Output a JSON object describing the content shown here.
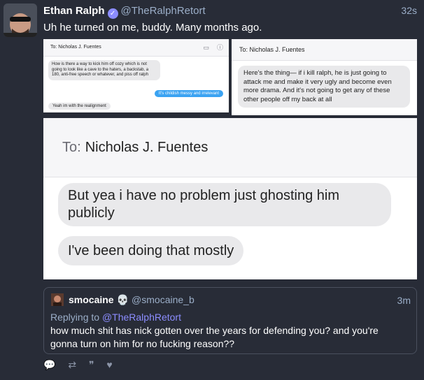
{
  "post": {
    "display_name": "Ethan Ralph",
    "handle": "@TheRalphRetort",
    "time": "32s",
    "text": "Uh he turned on me, buddy. Many months ago.",
    "verified_glyph": "✓"
  },
  "screenshot1": {
    "to": "To: Nicholas J. Fuentes",
    "msg1": "How is there a way to kick him off cozy which is not going to look like a cave to the haters, a backstab, a 180, anti-free speech or whatever, and piss off ralph",
    "msg2": "It's childish messy and irrelevant",
    "msg3": "Yeah im with the realignment",
    "icon_video": "▭",
    "icon_info": "ⓘ"
  },
  "screenshot2": {
    "to": "To: Nicholas J. Fuentes",
    "msg": "Here's the thing— if i kill ralph, he is just going to attack me and make it very ugly and become even more drama. And it's not going to get any of these other people off my back at all"
  },
  "screenshot3": {
    "to_label": "To:",
    "to_name": "Nicholas J. Fuentes",
    "msg1": "But yea i have no problem just ghosting him publicly",
    "msg2": "I've been doing that mostly"
  },
  "quote": {
    "display_name": "smocaine",
    "skull": "💀",
    "handle": "@smocaine_b",
    "time": "3m",
    "replying_label": "Replying to",
    "replying_mention": "@TheRalphRetort",
    "text": "how much shit has nick gotten over the years for defending you? and you're gonna turn on him for no fucking reason??"
  },
  "actions": {
    "reply": "💬",
    "boost": "⇄",
    "quote": "❞",
    "like": "♥"
  },
  "colors": {
    "background": "#282c37",
    "accent": "#8c8dff",
    "muted": "#9baec8",
    "imessage_blue": "#3ba3f2"
  }
}
